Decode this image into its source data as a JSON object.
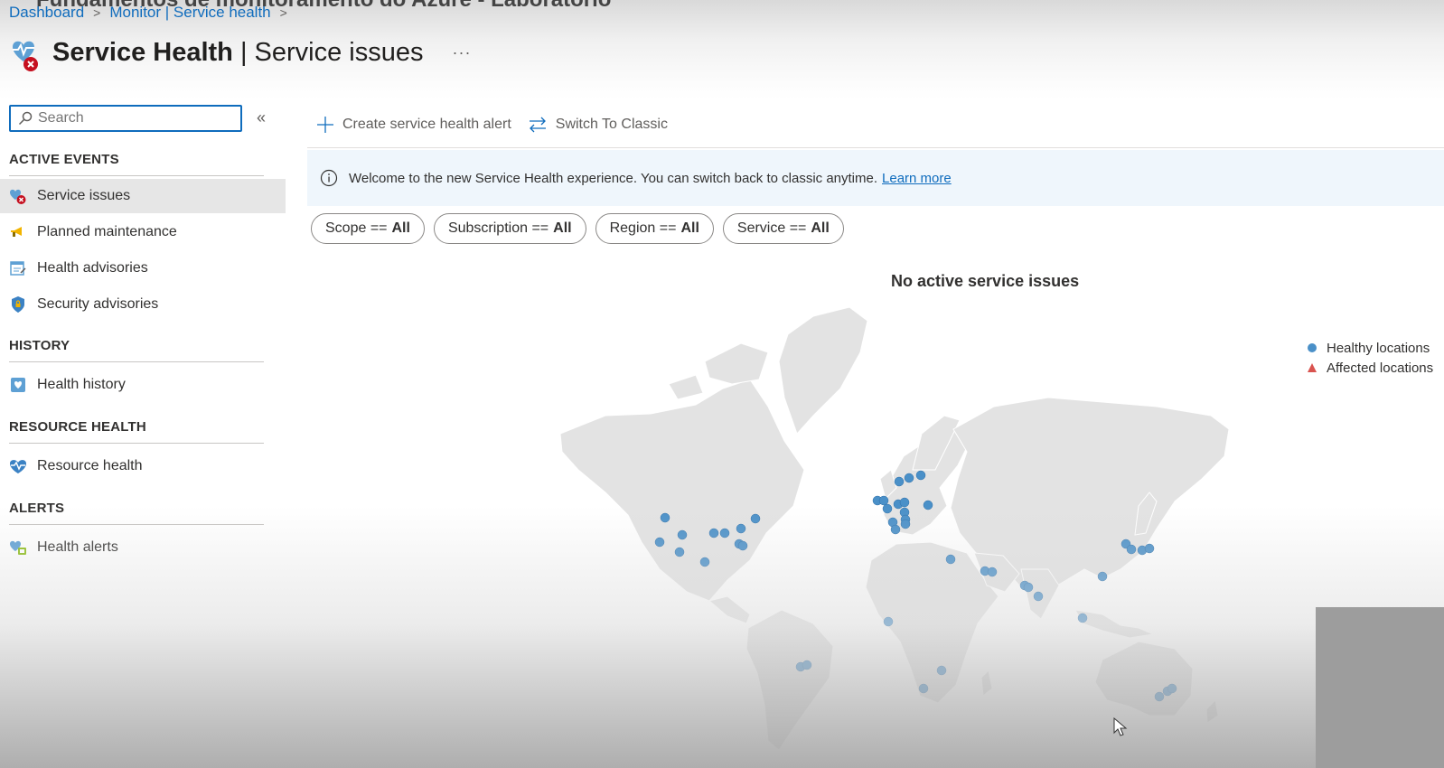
{
  "window": {
    "partial_title": "Fundamentos de monitoramento do Azure - Laboratório"
  },
  "breadcrumb": {
    "items": [
      "Dashboard",
      "Monitor | Service health"
    ]
  },
  "header": {
    "title_bold": "Service Health",
    "separator": " | ",
    "title_light": "Service issues",
    "more": "···"
  },
  "sidebar": {
    "search": {
      "placeholder": "Search",
      "value": ""
    },
    "collapse": "«",
    "sections": [
      {
        "heading": "ACTIVE EVENTS",
        "items": [
          {
            "label": "Service issues",
            "icon": "service-issues-icon",
            "selected": true
          },
          {
            "label": "Planned maintenance",
            "icon": "megaphone-icon"
          },
          {
            "label": "Health advisories",
            "icon": "calendar-icon"
          },
          {
            "label": "Security advisories",
            "icon": "shield-icon"
          }
        ]
      },
      {
        "heading": "HISTORY",
        "items": [
          {
            "label": "Health history",
            "icon": "heart-calendar-icon"
          }
        ]
      },
      {
        "heading": "RESOURCE HEALTH",
        "items": [
          {
            "label": "Resource health",
            "icon": "heartbeat-icon"
          }
        ]
      },
      {
        "heading": "ALERTS",
        "items": [
          {
            "label": "Health alerts",
            "icon": "health-alerts-icon"
          }
        ]
      }
    ]
  },
  "toolbar": {
    "create_label": "Create service health alert",
    "switch_label": "Switch To Classic"
  },
  "banner": {
    "text": "Welcome to the new Service Health experience. You can switch back to classic anytime.",
    "link": "Learn more"
  },
  "filters": [
    {
      "label": "Scope ==",
      "value": "All"
    },
    {
      "label": "Subscription ==",
      "value": "All"
    },
    {
      "label": "Region ==",
      "value": "All"
    },
    {
      "label": "Service ==",
      "value": "All"
    }
  ],
  "status": {
    "message": "No active service issues"
  },
  "legend": {
    "healthy": "Healthy locations",
    "affected": "Affected locations"
  },
  "colors": {
    "accent": "#0f6cbd",
    "healthy": "#4a90c8",
    "affected": "#d9534f",
    "banner_bg": "#eff6fc"
  }
}
